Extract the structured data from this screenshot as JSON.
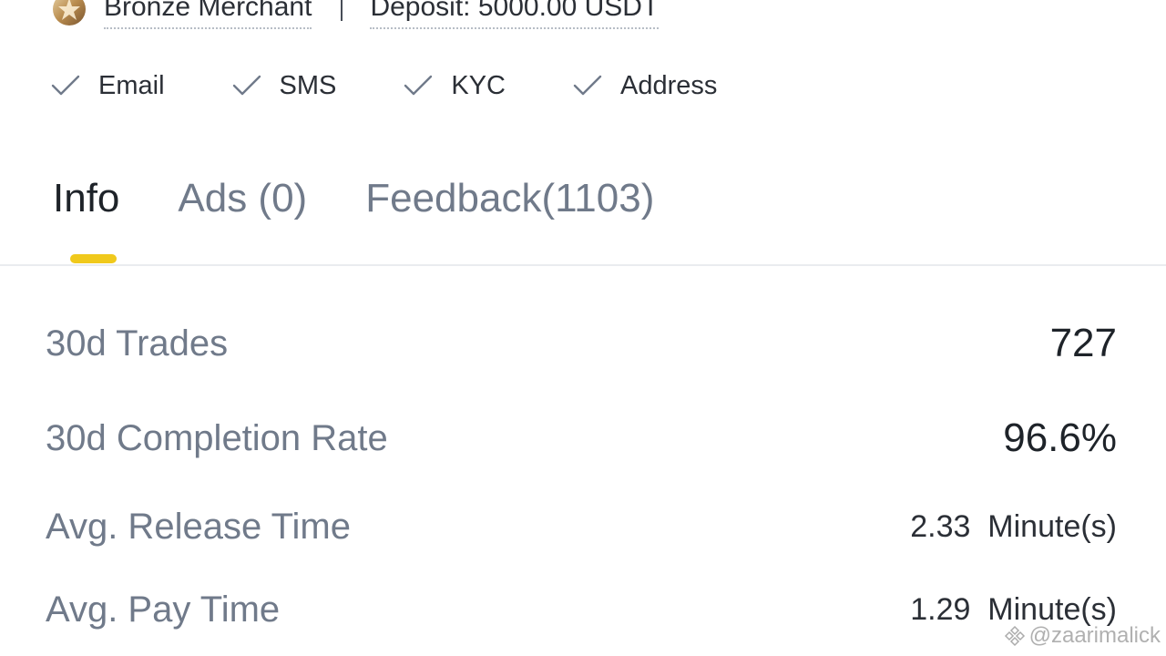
{
  "header": {
    "badge_icon": "bronze-badge-icon",
    "merchant_level": "Bronze Merchant",
    "deposit": "Deposit: 5000.00 USDT"
  },
  "verifications": [
    {
      "label": "Email",
      "icon": "check-icon"
    },
    {
      "label": "SMS",
      "icon": "check-icon"
    },
    {
      "label": "KYC",
      "icon": "check-icon"
    },
    {
      "label": "Address",
      "icon": "check-icon"
    }
  ],
  "tabs": [
    {
      "label": "Info",
      "active": true
    },
    {
      "label": "Ads (0)",
      "active": false
    },
    {
      "label": "Feedback(1103)",
      "active": false
    }
  ],
  "stats": [
    {
      "label": "30d Trades",
      "value": "727"
    },
    {
      "label": "30d Completion Rate",
      "value": "96.6%"
    },
    {
      "label": "Avg. Release Time",
      "value": "2.33  Minute(s)"
    },
    {
      "label": "Avg. Pay Time",
      "value": "1.29  Minute(s)"
    }
  ],
  "watermark": {
    "text": "@zaarimalick"
  },
  "colors": {
    "accent": "#f0c91c",
    "text_primary": "#1e2329",
    "text_secondary": "#707a8a",
    "divider": "#eaecef"
  }
}
